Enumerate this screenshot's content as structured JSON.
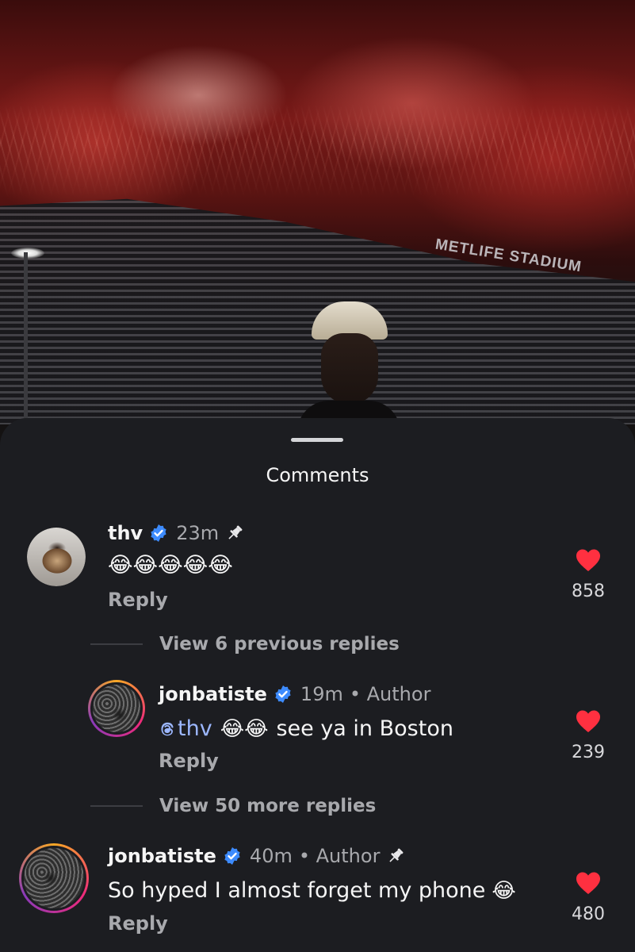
{
  "background": {
    "stadium_sign": "METLIFE STADIUM"
  },
  "sheet": {
    "title": "Comments"
  },
  "comments": [
    {
      "username": "thv",
      "verified": true,
      "time": "23m",
      "pinned": true,
      "text": "😂😂😂😂😂",
      "reply_label": "Reply",
      "likes": "858",
      "liked": true
    },
    {
      "username": "jonbatiste",
      "verified": true,
      "time": "19m",
      "author_tag": "• Author",
      "mention": "thv",
      "emojis": "😂😂",
      "text_after": "see ya in Boston",
      "reply_label": "Reply",
      "likes": "239",
      "liked": true
    },
    {
      "username": "jonbatiste",
      "verified": true,
      "time": "40m",
      "author_tag": "• Author",
      "pinned": true,
      "text": "So hyped I almost forget my phone",
      "emoji": "😂",
      "reply_label": "Reply",
      "likes": "480",
      "liked": true
    }
  ],
  "threads": {
    "previous": "View 6 previous replies",
    "more": "View 50 more replies"
  },
  "colors": {
    "sheet_bg": "#1c1d21",
    "like_red": "#ff3040",
    "verified_blue": "#3d8bfd",
    "mention": "#9cb7ff"
  }
}
